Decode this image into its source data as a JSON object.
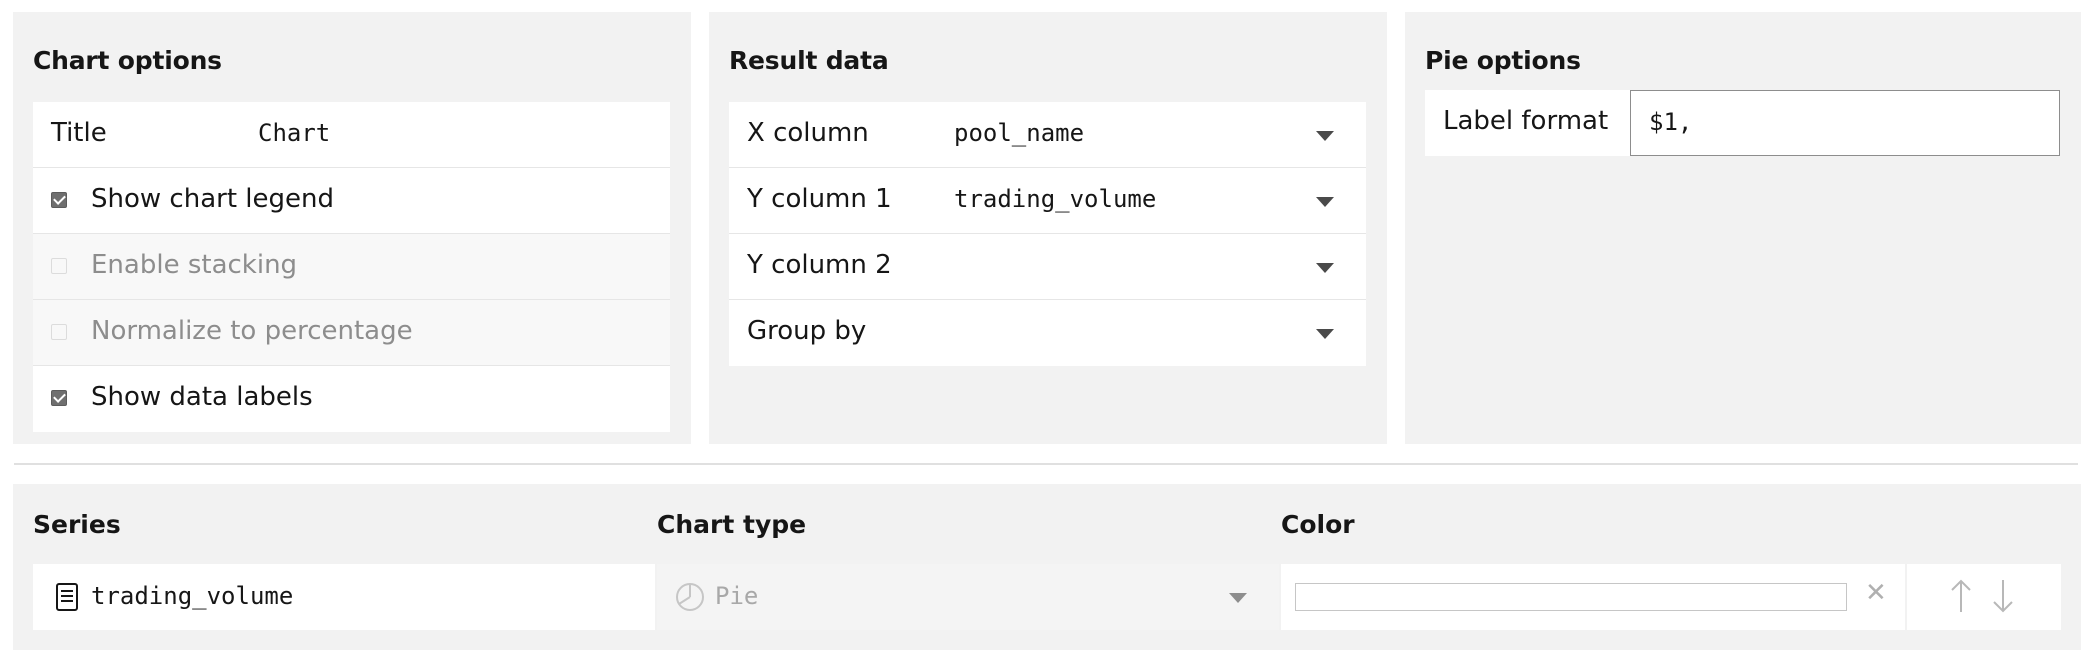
{
  "chart_options": {
    "title": "Chart options",
    "title_label": "Title",
    "title_value": "Chart",
    "checkboxes": [
      {
        "label": "Show chart legend",
        "checked": true,
        "enabled": true
      },
      {
        "label": "Enable stacking",
        "checked": false,
        "enabled": false
      },
      {
        "label": "Normalize to percentage",
        "checked": false,
        "enabled": false
      },
      {
        "label": "Show data labels",
        "checked": true,
        "enabled": true
      }
    ]
  },
  "result_data": {
    "title": "Result data",
    "fields": [
      {
        "label": "X column",
        "value": "pool_name"
      },
      {
        "label": "Y column 1",
        "value": "trading_volume"
      },
      {
        "label": "Y column 2",
        "value": ""
      },
      {
        "label": "Group by",
        "value": ""
      }
    ]
  },
  "pie_options": {
    "title": "Pie options",
    "label_format_label": "Label format",
    "label_format_value": "$1,"
  },
  "series_table": {
    "headers": {
      "series": "Series",
      "chart_type": "Chart type",
      "color": "Color"
    },
    "rows": [
      {
        "series": "trading_volume",
        "chart_type": "Pie",
        "color": "",
        "icon": "document-icon",
        "type_icon": "pie-chart-icon"
      }
    ]
  },
  "colors": {
    "panel_bg": "#f2f2f2",
    "text": "#161616",
    "disabled_text": "#8d8d8d",
    "accent_disabled": "#c6c6c6"
  }
}
